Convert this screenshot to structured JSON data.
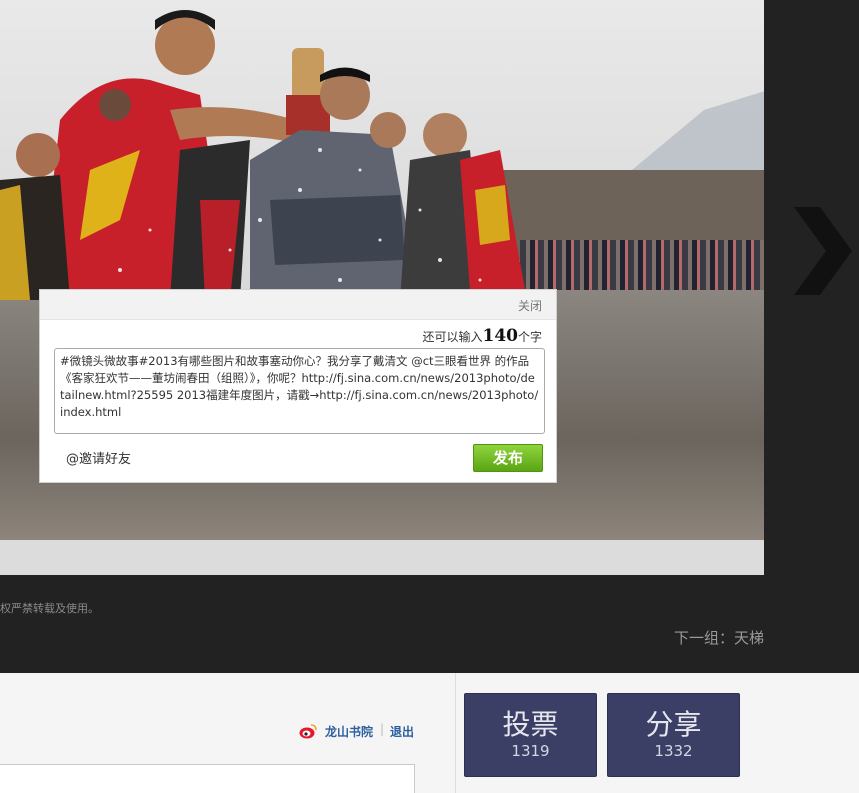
{
  "dialog": {
    "close_label": "关闭",
    "counter_prefix": "还可以输入",
    "counter_value": "140",
    "counter_suffix": "个字",
    "share_text": "#微镜头微故事#2013有哪些图片和故事塞动你心？我分享了戴清文 @ct三眼看世界 的作品《客家狂欢节——董坊闹春田（组照）》，你呢？http://fj.sina.com.cn/news/2013photo/detailnew.html?25595 2013福建年度图片，请戳→http://fj.sina.com.cn/news/2013photo/index.html",
    "invite_label": "@邀请好友",
    "publish_label": "发布"
  },
  "caption": {
    "copyright_text": "权严禁转载及使用。",
    "next_group_prefix": "下一组：",
    "next_group_name": "天梯"
  },
  "user_bar": {
    "username": "龙山书院",
    "separator": "|",
    "logout_label": "退出"
  },
  "actions": {
    "vote_label": "投票",
    "vote_count": "1319",
    "share_label": "分享",
    "share_count": "1332"
  },
  "colors": {
    "background_dark": "#222222",
    "publish_green": "#5aa514",
    "action_button": "#3b3f66",
    "link_blue": "#2d5e9e"
  },
  "icons": [
    "chevron-right-icon",
    "weibo-icon"
  ]
}
